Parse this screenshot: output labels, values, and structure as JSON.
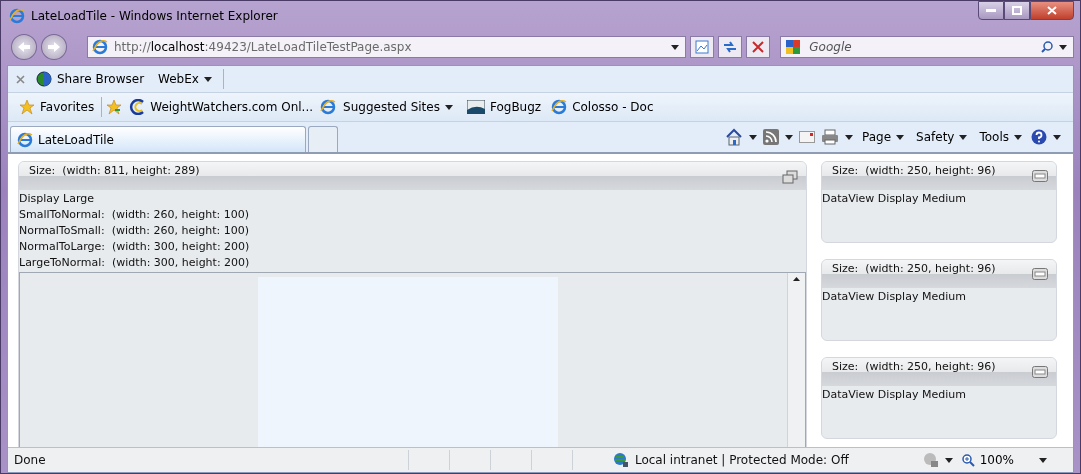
{
  "window": {
    "title": "LateLoadTile - Windows Internet Explorer"
  },
  "address": {
    "url": "http://**localhost**:49423/LateLoadTileTestPage.aspx"
  },
  "search": {
    "placeholder": "Google"
  },
  "command_bar": {
    "items": [
      {
        "label": "Share Browser",
        "kind": "globe"
      },
      {
        "label": "WebEx",
        "kind": "menu"
      }
    ]
  },
  "favorites_bar": {
    "items": [
      {
        "label": "Favorites",
        "kind": "star"
      },
      {
        "label": "WeightWatchers.com Onl...",
        "kind": "swirl"
      },
      {
        "label": "Suggested Sites",
        "kind": "menu"
      },
      {
        "label": "FogBugz",
        "kind": "fog"
      },
      {
        "label": "Colosso - Doc",
        "kind": "ie"
      }
    ]
  },
  "tabs": [
    {
      "label": "LateLoadTile",
      "selected": true
    }
  ],
  "tools": [
    "Page",
    "Safety",
    "Tools"
  ],
  "main_tile": {
    "size": "Size:  (width: 811, height: 289)",
    "lines": [
      "Display Large",
      "SmallToNormal:  (width: 260, height: 100)",
      "NormalToSmall:  (width: 260, height: 100)",
      "NormalToLarge:  (width: 300, height: 200)",
      "LargeToNormal:  (width: 300, height: 200)"
    ]
  },
  "side_tiles": [
    {
      "size": "Size:  (width: 250, height: 96)",
      "body": "DataView Display Medium"
    },
    {
      "size": "Size:  (width: 250, height: 96)",
      "body": "DataView Display Medium"
    },
    {
      "size": "Size:  (width: 250, height: 96)",
      "body": "DataView Display Medium"
    }
  ],
  "status_bar": {
    "text": "Done",
    "zone": "Local intranet | Protected Mode: Off",
    "zoom": "100%"
  }
}
